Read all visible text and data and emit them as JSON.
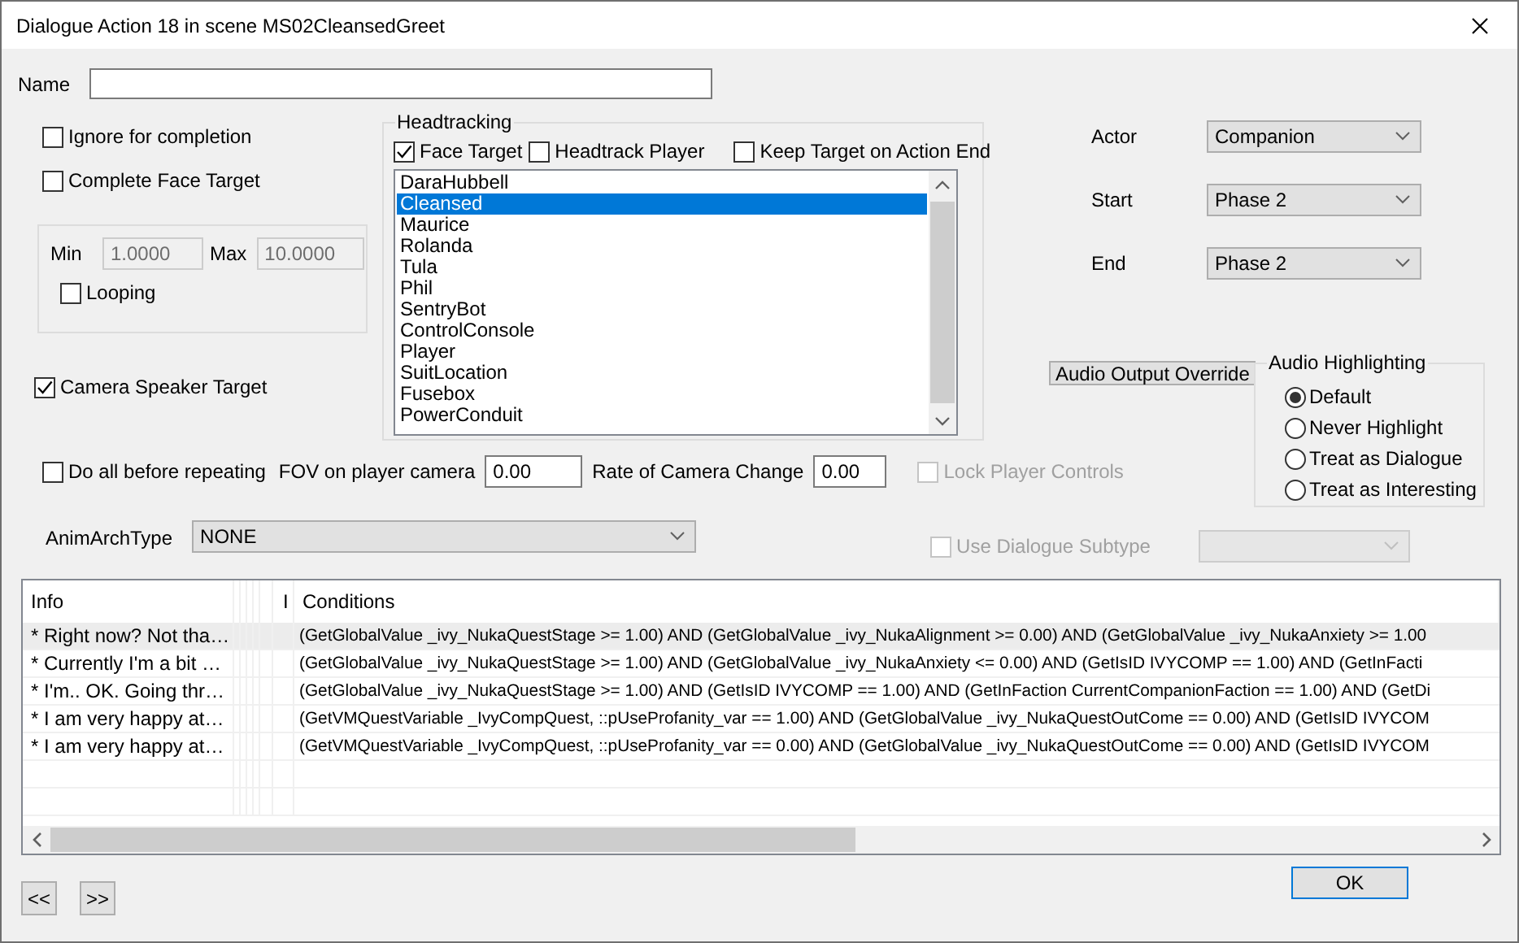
{
  "window": {
    "title": "Dialogue Action 18 in scene MS02CleansedGreet"
  },
  "name_field": {
    "label": "Name"
  },
  "options": [
    {
      "label": "Ignore for completion",
      "checked": false
    },
    {
      "label": "Complete Face Target",
      "checked": false
    }
  ],
  "range": {
    "min_label": "Min",
    "min": "1.0000",
    "max_label": "Max",
    "max": "10.0000",
    "disabled": true,
    "looping": {
      "label": "Looping",
      "checked": false
    }
  },
  "camera_speaker_target": {
    "label": "Camera Speaker Target",
    "checked": true
  },
  "headtracking": {
    "title": "Headtracking",
    "options": [
      {
        "label": "Face Target",
        "checked": true
      },
      {
        "label": "Headtrack Player",
        "checked": false
      },
      {
        "label": "Keep Target on Action End",
        "checked": false
      }
    ],
    "targets": [
      {
        "label": "DaraHubbell",
        "selected": false
      },
      {
        "label": "Cleansed",
        "selected": true
      },
      {
        "label": "Maurice",
        "selected": false
      },
      {
        "label": "Rolanda",
        "selected": false
      },
      {
        "label": "Tula",
        "selected": false
      },
      {
        "label": "Phil",
        "selected": false
      },
      {
        "label": "SentryBot",
        "selected": false
      },
      {
        "label": "ControlConsole",
        "selected": false
      },
      {
        "label": "Player",
        "selected": false
      },
      {
        "label": "SuitLocation",
        "selected": false
      },
      {
        "label": "Fusebox",
        "selected": false
      },
      {
        "label": "PowerConduit",
        "selected": false
      }
    ]
  },
  "selectors": [
    {
      "label": "Actor",
      "value": "Companion"
    },
    {
      "label": "Start",
      "value": "Phase 2"
    },
    {
      "label": "End",
      "value": "Phase 2"
    }
  ],
  "audio_output_override": {
    "label": "Audio Output Override"
  },
  "audio_highlighting": {
    "title": "Audio Highlighting",
    "choices": [
      {
        "label": "Default",
        "selected": true
      },
      {
        "label": "Never Highlight",
        "selected": false
      },
      {
        "label": "Treat as Dialogue",
        "selected": false
      },
      {
        "label": "Treat as Interesting",
        "selected": false
      }
    ]
  },
  "camera": {
    "do_all": {
      "label": "Do all before repeating",
      "checked": false
    },
    "fov": {
      "label": "FOV on player camera",
      "value": "0.00"
    },
    "rate": {
      "label": "Rate of Camera Change",
      "value": "0.00"
    },
    "lock": {
      "label": "Lock Player Controls",
      "checked": false,
      "disabled": true
    }
  },
  "anim_arch": {
    "label": "AnimArchType",
    "value": "NONE"
  },
  "dialogue_subtype": {
    "label": "Use Dialogue Subtype",
    "checked": false,
    "disabled": true
  },
  "table": {
    "columns": [
      "Info",
      "I",
      "Conditions"
    ],
    "rows": [
      {
        "info": "* Right now? Not tha…",
        "conditions": "(GetGlobalValue _ivy_NukaQuestStage >= 1.00) AND (GetGlobalValue _ivy_NukaAlignment >= 0.00) AND (GetGlobalValue _ivy_NukaAnxiety >= 1.00",
        "selected": true
      },
      {
        "info": "* Currently I'm a bit …",
        "conditions": "(GetGlobalValue _ivy_NukaQuestStage >= 1.00) AND (GetGlobalValue _ivy_NukaAnxiety <= 0.00) AND (GetIsID IVYCOMP == 1.00) AND (GetInFacti",
        "selected": false
      },
      {
        "info": "* I'm.. OK. Going thr…",
        "conditions": "(GetGlobalValue _ivy_NukaQuestStage >= 1.00) AND (GetIsID IVYCOMP == 1.00) AND (GetInFaction CurrentCompanionFaction == 1.00) AND (GetDi",
        "selected": false
      },
      {
        "info": "* I am very happy at…",
        "conditions": "(GetVMQuestVariable _IvyCompQuest, ::pUseProfanity_var == 1.00) AND (GetGlobalValue _ivy_NukaQuestOutCome == 0.00) AND (GetIsID IVYCOM",
        "selected": false
      },
      {
        "info": "* I am very happy at…",
        "conditions": "(GetVMQuestVariable _IvyCompQuest, ::pUseProfanity_var == 0.00) AND (GetGlobalValue _ivy_NukaQuestOutCome == 0.00) AND (GetIsID IVYCOM",
        "selected": false
      }
    ]
  },
  "nav_buttons": [
    "<<",
    ">>"
  ],
  "ok_button": "OK"
}
